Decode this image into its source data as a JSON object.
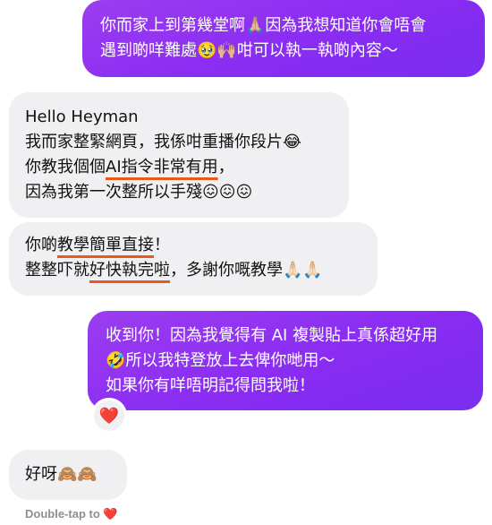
{
  "messages": [
    {
      "id": "m1",
      "sender": "me",
      "lines": [
        "你而家上到第幾堂啊🙏🏼因為我想知道你會唔會",
        "遇到啲咩難處🥹🙌🏼咁可以執一執啲內容～"
      ]
    },
    {
      "id": "m2",
      "sender": "them",
      "lines": [
        "Hello Heyman",
        "我而家整緊網頁，我係咁重播你段片😂",
        "你教我個個",
        "AI指令非常有用",
        "，",
        "因為我第一次整所以手殘😖😖😖"
      ]
    },
    {
      "id": "m3",
      "sender": "them",
      "lines": [
        "你啲",
        "教學簡單直接",
        "！",
        "整整吓就",
        "好快執完啦",
        "，多謝你嘅教學🙏🏻🙏🏻"
      ]
    },
    {
      "id": "m4",
      "sender": "me",
      "lines": [
        "收到你！因為我覺得有 AI 複製貼上真係超好用",
        "🤣所以我特登放上去俾你哋用～",
        "如果你有咩唔明記得問我啦！"
      ],
      "reaction": "❤️"
    },
    {
      "id": "m5",
      "sender": "them",
      "lines": [
        "好呀🙈🙈"
      ]
    }
  ],
  "footer": {
    "text": "Double-tap to",
    "heart": "❤️"
  },
  "colors": {
    "outgoing": "#8a2cf2",
    "incoming": "#f0f0f3",
    "underline": "#e85a1b"
  }
}
